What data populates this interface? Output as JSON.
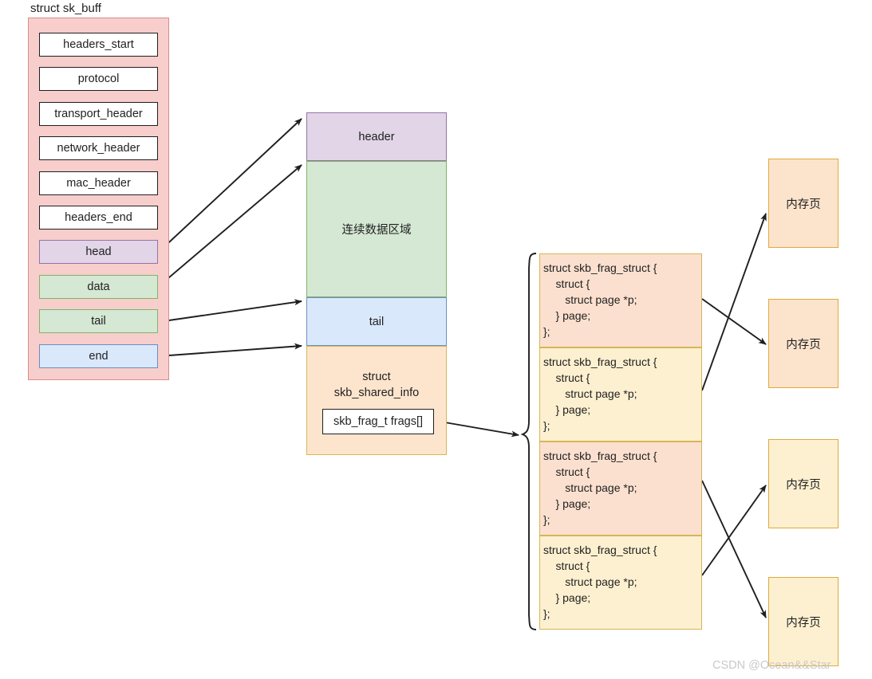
{
  "diagram": {
    "title": "struct sk_buff",
    "watermark": "CSDN @Ocean&&Star"
  },
  "skbuff": {
    "label": "struct sk_buff",
    "fields": [
      {
        "name": "headers_start",
        "label": "headers_start"
      },
      {
        "name": "protocol",
        "label": "protocol"
      },
      {
        "name": "transport_header",
        "label": "transport_header"
      },
      {
        "name": "network_header",
        "label": "network_header"
      },
      {
        "name": "mac_header",
        "label": "mac_header"
      },
      {
        "name": "headers_end",
        "label": "headers_end"
      },
      {
        "name": "head",
        "label": "head"
      },
      {
        "name": "data",
        "label": "data"
      },
      {
        "name": "tail",
        "label": "tail"
      },
      {
        "name": "end",
        "label": "end"
      }
    ]
  },
  "buffer": {
    "segments": [
      {
        "name": "header",
        "label": "header"
      },
      {
        "name": "data-region",
        "label": "连续数据区域"
      },
      {
        "name": "tail",
        "label": "tail"
      }
    ],
    "shared_info": {
      "line1": "struct",
      "line2": "skb_shared_info",
      "frags_label": "skb_frag_t frags[]"
    }
  },
  "frags": [
    {
      "name": "frag-0",
      "text": "struct skb_frag_struct {\n    struct {\n       struct page *p;\n    } page;\n};"
    },
    {
      "name": "frag-1",
      "text": "struct skb_frag_struct {\n    struct {\n       struct page *p;\n    } page;\n};"
    },
    {
      "name": "frag-2",
      "text": "struct skb_frag_struct {\n    struct {\n       struct page *p;\n    } page;\n};"
    },
    {
      "name": "frag-3",
      "text": "struct skb_frag_struct {\n    struct {\n       struct page *p;\n    } page;\n};"
    }
  ],
  "memory_pages": [
    {
      "name": "memory-page-0",
      "label": "内存页"
    },
    {
      "name": "memory-page-1",
      "label": "内存页"
    },
    {
      "name": "memory-page-2",
      "label": "内存页"
    },
    {
      "name": "memory-page-3",
      "label": "内存页"
    }
  ],
  "colors": {
    "skbuff_fill": "#f7cecc",
    "skbuff_border": "#d98d8b",
    "header_fill": "#e1d5e7",
    "header_border": "#9673a6",
    "data_fill": "#d5e8d4",
    "data_border": "#82b366",
    "tail_fill": "#dae8fc",
    "tail_border": "#6c8ebf",
    "shared_fill": "#fde5cd",
    "frag_odd_fill": "#fbe0cf",
    "frag_even_fill": "#fdf0d0",
    "frag_border": "#d6b656",
    "page_peach_fill": "#fce3cc",
    "page_yellow_fill": "#fdf0d0",
    "page_border": "#e0a93b",
    "arrow": "#1f1f1f",
    "watermark": "#c9c9c9"
  }
}
